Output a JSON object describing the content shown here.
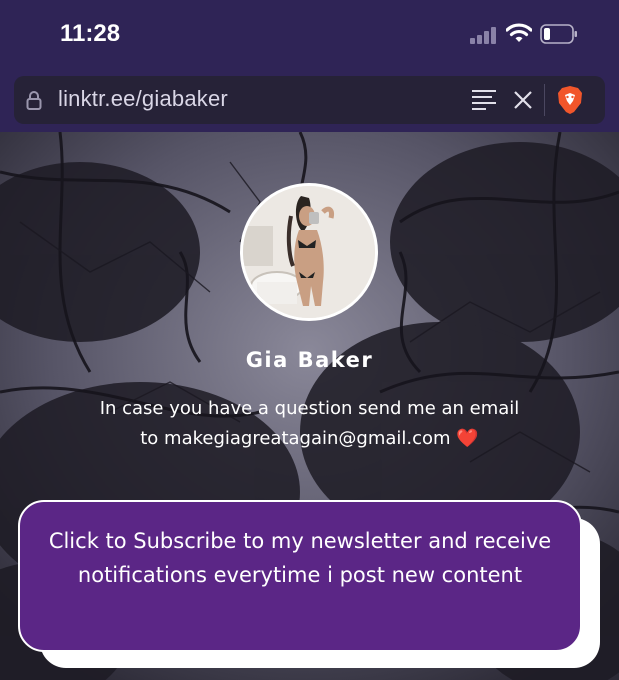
{
  "status_bar": {
    "time": "11:28"
  },
  "browser": {
    "url": "linktr.ee/giabaker"
  },
  "profile": {
    "name": "Gia Baker",
    "bio_line1": "In case you have a question send me an email",
    "bio_line2": "to makegiagreatagain@gmail.com",
    "bio_emoji": "❤️"
  },
  "links": [
    {
      "label": "Click to Subscribe to my newsletter and receive notifications everytime i post new content"
    }
  ],
  "colors": {
    "chrome_bg": "#2f2456",
    "url_bar_bg": "#262237",
    "button_bg": "#5b2686",
    "button_border": "#ffffff",
    "heart": "#e2283a"
  },
  "icons": {
    "status": [
      "signal-icon",
      "wifi-icon",
      "battery-icon"
    ],
    "browser": [
      "lock-icon",
      "reader-mode-icon",
      "close-icon",
      "brave-shield-icon"
    ]
  }
}
